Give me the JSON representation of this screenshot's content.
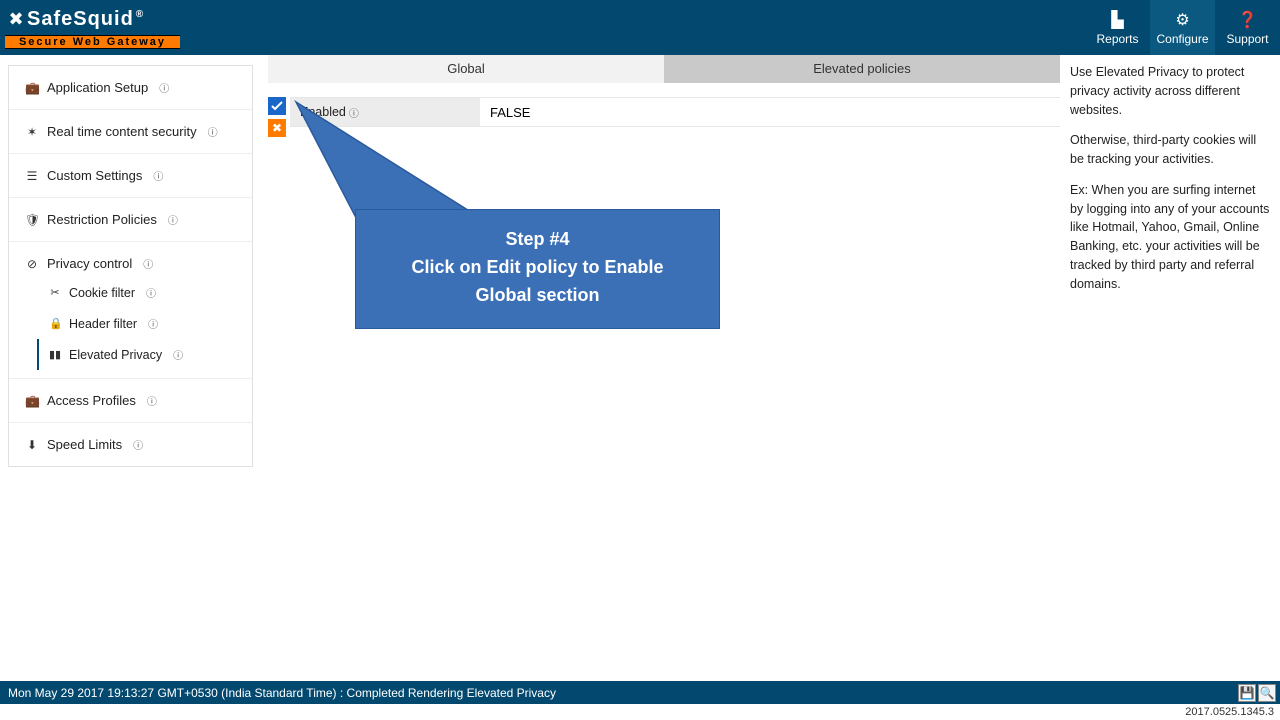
{
  "header": {
    "logo_main": "SafeSquid",
    "logo_reg": "®",
    "logo_tag": "Secure Web Gateway",
    "nav": {
      "reports": "Reports",
      "configure": "Configure",
      "support": "Support"
    }
  },
  "sidebar": {
    "items": [
      {
        "label": "Application Setup",
        "icon": "💼"
      },
      {
        "label": "Real time content security",
        "icon": "✶"
      },
      {
        "label": "Custom Settings",
        "icon": "⚙"
      },
      {
        "label": "Restriction Policies",
        "icon": "🛡"
      },
      {
        "label": "Privacy control",
        "icon": "⊘",
        "children": [
          {
            "label": "Cookie filter",
            "icon": "✂"
          },
          {
            "label": "Header filter",
            "icon": "🔒"
          },
          {
            "label": "Elevated Privacy",
            "icon": "▮▮",
            "active": true
          }
        ]
      },
      {
        "label": "Access Profiles",
        "icon": "💼"
      },
      {
        "label": "Speed Limits",
        "icon": "⬇"
      }
    ]
  },
  "tabs": {
    "global": "Global",
    "elevated": "Elevated policies"
  },
  "policy": {
    "enabled_label": "Enabled",
    "enabled_value": "FALSE"
  },
  "callout": {
    "title": "Step #4",
    "line1": "Click on Edit policy to Enable",
    "line2": "Global section"
  },
  "info": {
    "p1": "Use Elevated Privacy to protect privacy activity across different websites.",
    "p2": "Otherwise, third-party cookies will be tracking your activities.",
    "p3": "Ex: When you are surfing internet by logging into any of your accounts like Hotmail, Yahoo, Gmail, Online Banking, etc. your activities will be tracked by third party and referral domains."
  },
  "status": "Mon May 29 2017 19:13:27 GMT+0530 (India Standard Time) : Completed Rendering Elevated Privacy",
  "version": "2017.0525.1345.3"
}
